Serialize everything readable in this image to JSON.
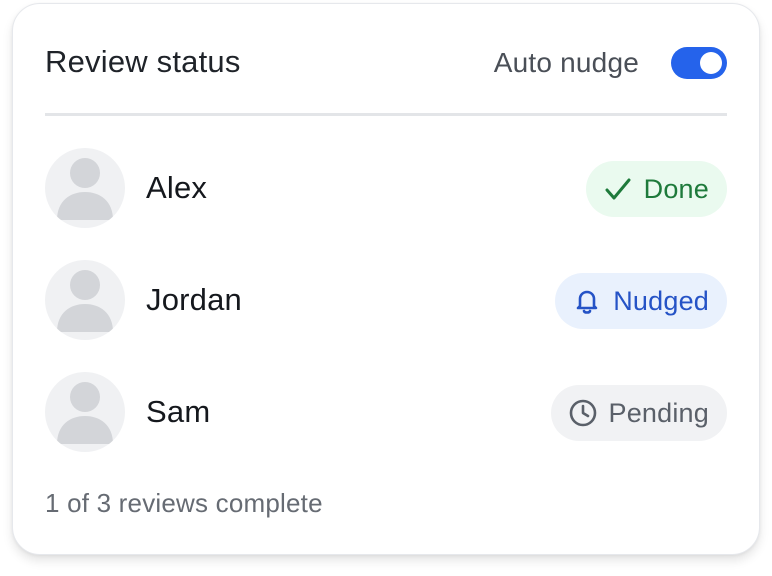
{
  "header": {
    "title": "Review status",
    "auto_nudge_label": "Auto nudge",
    "auto_nudge_on": true
  },
  "reviewers": [
    {
      "name": "Alex",
      "status": "Done",
      "status_icon": "check-icon"
    },
    {
      "name": "Jordan",
      "status": "Nudged",
      "status_icon": "bell-icon"
    },
    {
      "name": "Sam",
      "status": "Pending",
      "status_icon": "clock-icon"
    }
  ],
  "footer": {
    "summary": "1 of 3 reviews complete"
  },
  "colors": {
    "accent": "#2563eb",
    "done": "#1e7a3b",
    "nudged": "#2553c6",
    "pending": "#5a6069"
  }
}
